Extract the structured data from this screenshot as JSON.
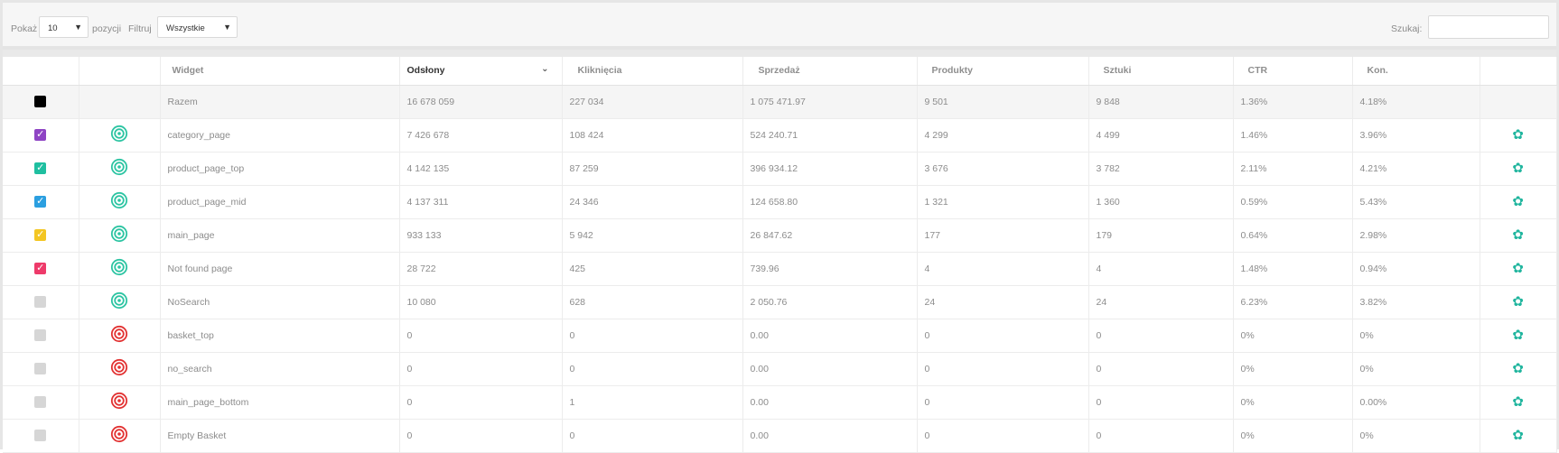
{
  "toolbar": {
    "show_label": "Pokaż",
    "page_size": "10",
    "positions_label": "pozycji",
    "filter_label": "Filtruj",
    "filter_value": "Wszystkie",
    "search_label": "Szukaj:",
    "search_value": ""
  },
  "table": {
    "columns": [
      "Widget",
      "Odsłony",
      "Kliknięcia",
      "Sprzedaż",
      "Produkty",
      "Sztuki",
      "CTR",
      "Kon."
    ],
    "sorted_column": "Odsłony",
    "total": {
      "checkbox_color": "#000000",
      "name": "Razem",
      "views": "16 678 059",
      "clicks": "227 034",
      "sales": "1 075 471.97",
      "products": "9 501",
      "pieces": "9 848",
      "ctr": "1.36%",
      "conv": "4.18%"
    },
    "rows": [
      {
        "checked": true,
        "color": "#8e44c4",
        "status": "active",
        "name": "category_page",
        "views": "7 426 678",
        "clicks": "108 424",
        "sales": "524 240.71",
        "products": "4 299",
        "pieces": "4 499",
        "ctr": "1.46%",
        "conv": "3.96%"
      },
      {
        "checked": true,
        "color": "#1fbfa0",
        "status": "active",
        "name": "product_page_top",
        "views": "4 142 135",
        "clicks": "87 259",
        "sales": "396 934.12",
        "products": "3 676",
        "pieces": "3 782",
        "ctr": "2.11%",
        "conv": "4.21%"
      },
      {
        "checked": true,
        "color": "#2b9fe0",
        "status": "active",
        "name": "product_page_mid",
        "views": "4 137 311",
        "clicks": "24 346",
        "sales": "124 658.80",
        "products": "1 321",
        "pieces": "1 360",
        "ctr": "0.59%",
        "conv": "5.43%"
      },
      {
        "checked": true,
        "color": "#f3c623",
        "status": "active",
        "name": "main_page",
        "views": "933 133",
        "clicks": "5 942",
        "sales": "26 847.62",
        "products": "177",
        "pieces": "179",
        "ctr": "0.64%",
        "conv": "2.98%"
      },
      {
        "checked": true,
        "color": "#ee3a6a",
        "status": "active",
        "name": "Not found page",
        "views": "28 722",
        "clicks": "425",
        "sales": "739.96",
        "products": "4",
        "pieces": "4",
        "ctr": "1.48%",
        "conv": "0.94%"
      },
      {
        "checked": false,
        "color": "#d6d6d6",
        "status": "active",
        "name": "NoSearch",
        "views": "10 080",
        "clicks": "628",
        "sales": "2 050.76",
        "products": "24",
        "pieces": "24",
        "ctr": "6.23%",
        "conv": "3.82%"
      },
      {
        "checked": false,
        "color": "#d6d6d6",
        "status": "inactive",
        "name": "basket_top",
        "views": "0",
        "clicks": "0",
        "sales": "0.00",
        "products": "0",
        "pieces": "0",
        "ctr": "0%",
        "conv": "0%"
      },
      {
        "checked": false,
        "color": "#d6d6d6",
        "status": "inactive",
        "name": "no_search",
        "views": "0",
        "clicks": "0",
        "sales": "0.00",
        "products": "0",
        "pieces": "0",
        "ctr": "0%",
        "conv": "0%"
      },
      {
        "checked": false,
        "color": "#d6d6d6",
        "status": "inactive",
        "name": "main_page_bottom",
        "views": "0",
        "clicks": "1",
        "sales": "0.00",
        "products": "0",
        "pieces": "0",
        "ctr": "0%",
        "conv": "0.00%"
      },
      {
        "checked": false,
        "color": "#d6d6d6",
        "status": "inactive",
        "name": "Empty Basket",
        "views": "0",
        "clicks": "0",
        "sales": "0.00",
        "products": "0",
        "pieces": "0",
        "ctr": "0%",
        "conv": "0%"
      }
    ]
  },
  "colors": {
    "active_icon": "#2cc4a2",
    "inactive_icon": "#e23232",
    "settings_icon": "#20b59e"
  },
  "icons": {
    "checkmark": "✓",
    "caret": "▼",
    "chevron": "⌄",
    "gear": "✿"
  }
}
